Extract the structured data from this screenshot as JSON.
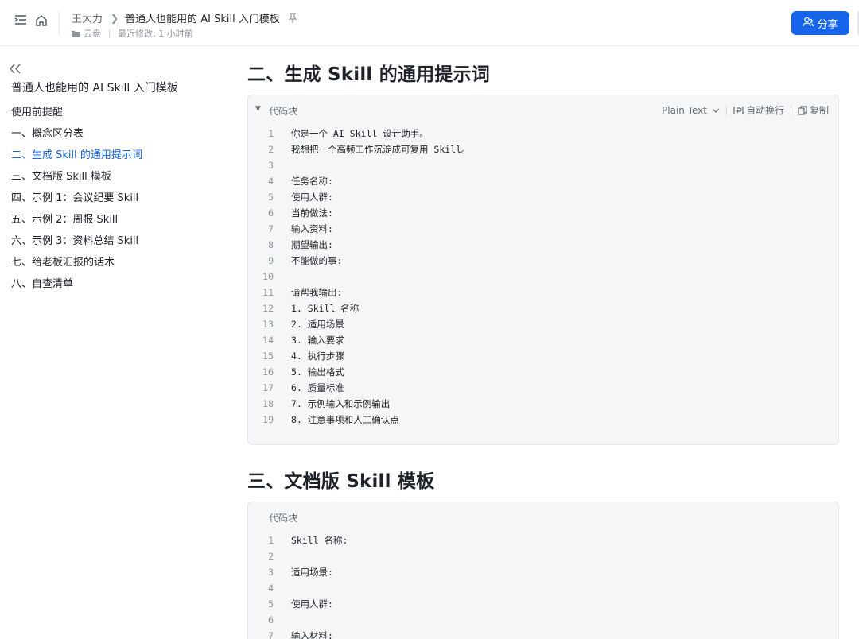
{
  "header": {
    "user": "王大力",
    "doc_title": "普通人也能用的 AI Skill 入门模板",
    "location": "云盘",
    "last_modified": "最近修改: 1 小时前",
    "share_label": "分享"
  },
  "toc": {
    "title": "普通人也能用的 AI Skill 入门模板",
    "items": [
      {
        "label": "使用前提醒"
      },
      {
        "label": "一、概念区分表"
      },
      {
        "label": "二、生成 Skill 的通用提示词"
      },
      {
        "label": "三、文档版 Skill 模板"
      },
      {
        "label": "四、示例 1：会议纪要 Skill"
      },
      {
        "label": "五、示例 2：周报 Skill"
      },
      {
        "label": "六、示例 3：资料总结 Skill"
      },
      {
        "label": "七、给老板汇报的话术"
      },
      {
        "label": "八、自查清单"
      }
    ],
    "active_index": 2
  },
  "sections": [
    {
      "heading": "二、生成 Skill 的通用提示词",
      "code": {
        "label": "代码块",
        "language": "Plain Text",
        "wrap_label": "自动换行",
        "copy_label": "复制",
        "lines": [
          {
            "n": "1",
            "text": "你是一个 AI Skill 设计助手。"
          },
          {
            "n": "2",
            "text": "我想把一个高频工作沉淀成可复用 Skill。"
          },
          {
            "n": "3",
            "text": ""
          },
          {
            "n": "4",
            "text": "任务名称:"
          },
          {
            "n": "5",
            "text": "使用人群:"
          },
          {
            "n": "6",
            "text": "当前做法:"
          },
          {
            "n": "7",
            "text": "输入资料:"
          },
          {
            "n": "8",
            "text": "期望输出:"
          },
          {
            "n": "9",
            "text": "不能做的事:"
          },
          {
            "n": "10",
            "text": ""
          },
          {
            "n": "11",
            "text": "请帮我输出:"
          },
          {
            "n": "12",
            "text": "1. Skill 名称"
          },
          {
            "n": "13",
            "text": "2. 适用场景"
          },
          {
            "n": "14",
            "text": "3. 输入要求"
          },
          {
            "n": "15",
            "text": "4. 执行步骤"
          },
          {
            "n": "16",
            "text": "5. 输出格式"
          },
          {
            "n": "17",
            "text": "6. 质量标准"
          },
          {
            "n": "18",
            "text": "7. 示例输入和示例输出"
          },
          {
            "n": "19",
            "text": "8. 注意事项和人工确认点"
          }
        ]
      }
    },
    {
      "heading": "三、文档版 Skill 模板",
      "code": {
        "label": "代码块",
        "lines": [
          {
            "n": "1",
            "text": "Skill 名称:"
          },
          {
            "n": "2",
            "text": ""
          },
          {
            "n": "3",
            "text": "适用场景:"
          },
          {
            "n": "4",
            "text": ""
          },
          {
            "n": "5",
            "text": "使用人群:"
          },
          {
            "n": "6",
            "text": ""
          },
          {
            "n": "7",
            "text": "输入材料:"
          }
        ]
      }
    }
  ]
}
